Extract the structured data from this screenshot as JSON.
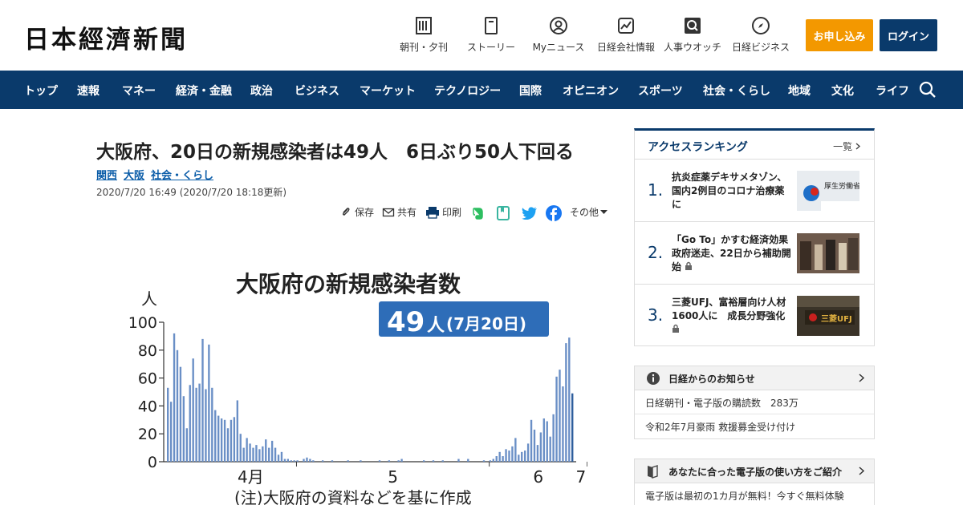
{
  "header": {
    "logo": "日本經濟新聞",
    "utility": [
      {
        "label": "朝刊・夕刊",
        "icon": "newspaper-icon"
      },
      {
        "label": "ストーリー",
        "icon": "book-icon"
      },
      {
        "label": "Myニュース",
        "icon": "user-icon"
      },
      {
        "label": "日経会社情報",
        "icon": "chart-icon"
      },
      {
        "label": "人事ウオッチ",
        "icon": "magnifier-icon"
      },
      {
        "label": "日経ビジネス",
        "icon": "compass-icon"
      }
    ],
    "subscribe_label": "お申し込み",
    "login_label": "ログイン"
  },
  "nav": {
    "items": [
      "トップ",
      "速報",
      "マネー",
      "経済・金融",
      "政治",
      "ビジネス",
      "マーケット",
      "テクノロジー",
      "国際",
      "オピニオン",
      "スポーツ",
      "社会・くらし",
      "地域",
      "文化",
      "ライフ"
    ]
  },
  "article": {
    "title": "大阪府、20日の新規感染者は49人　6日ぶり50人下回る",
    "tags": [
      "関西",
      "大阪",
      "社会・くらし"
    ],
    "date": "2020/7/20 16:49 (2020/7/20 18:18更新)",
    "share": {
      "save": "保存",
      "share": "共有",
      "print": "印刷",
      "more": "その他"
    }
  },
  "figure": {
    "title": "大阪府の新規感染者数",
    "badge_num": "49",
    "badge_unit": "人",
    "badge_date": "(7月20日)",
    "note": "(注)大阪府の資料などを基に作成"
  },
  "chart_data": {
    "type": "bar",
    "title": "大阪府の新規感染者数",
    "ylabel": "人",
    "ylim": [
      0,
      100
    ],
    "yticks": [
      0,
      20,
      40,
      60,
      80,
      100
    ],
    "month_labels": [
      "4月",
      "5",
      "6",
      "7"
    ],
    "highlight_color": "#2d5d9c",
    "bar_color": "#6a8fc6",
    "values": [
      53,
      43,
      92,
      80,
      68,
      47,
      24,
      55,
      74,
      53,
      56,
      88,
      52,
      84,
      53,
      37,
      33,
      31,
      30,
      24,
      30,
      32,
      44,
      20,
      10,
      17,
      13,
      10,
      12,
      9,
      11,
      16,
      10,
      15,
      10,
      5,
      7,
      2,
      2,
      1,
      1,
      1,
      0,
      2,
      3,
      2,
      1,
      0,
      0,
      1,
      0,
      0,
      1,
      0,
      0,
      0,
      0,
      1,
      0,
      0,
      0,
      1,
      0,
      0,
      0,
      0,
      0,
      1,
      0,
      0,
      1,
      0,
      0,
      1,
      2,
      0,
      0,
      0,
      0,
      0,
      0,
      1,
      0,
      0,
      1,
      0,
      0,
      1,
      0,
      0,
      0,
      0,
      2,
      0,
      0,
      2,
      0,
      0,
      0,
      0,
      1,
      0,
      1,
      2,
      4,
      7,
      4,
      9,
      8,
      11,
      17,
      5,
      7,
      8,
      13,
      30,
      23,
      12,
      21,
      31,
      29,
      18,
      34,
      61,
      66,
      54,
      85,
      89,
      49
    ],
    "month_starts": [
      12,
      41,
      102,
      133
    ],
    "latest_value": 49
  },
  "sidebar": {
    "ranking": {
      "title": "アクセスランキング",
      "more": "一覧",
      "items": [
        {
          "rank": "1.",
          "text": "抗炎症薬デキサメタゾン、国内2例目のコロナ治療薬に",
          "locked": false
        },
        {
          "rank": "2.",
          "text": "「Go To」かすむ経済効果　政府迷走、22日から補助開始",
          "locked": true
        },
        {
          "rank": "3.",
          "text": "三菱UFJ、富裕層向け人材1600人に　成長分野強化",
          "locked": true
        }
      ]
    },
    "info": {
      "title": "日経からのお知らせ",
      "rows": [
        "日経朝刊・電子版の購読数　283万",
        "令和2年7月豪雨 救援募金受け付け"
      ]
    },
    "guide": {
      "title": "あなたに合った電子版の使い方をご紹介",
      "row": "電子版は最初の1カ月が無料！今すぐ無料体験"
    },
    "thumb2_text": "厚生労働省",
    "thumb3_text": "三菱UFJ"
  }
}
